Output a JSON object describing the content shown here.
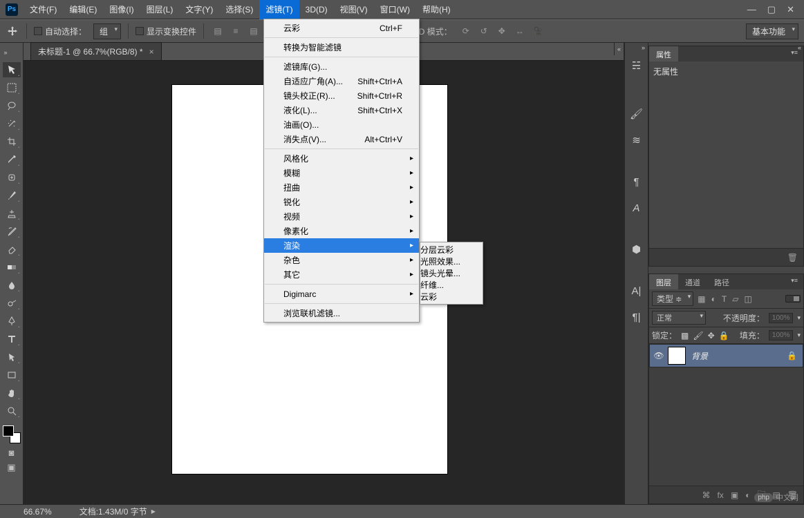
{
  "app": {
    "logo": "Ps"
  },
  "menu": {
    "items": [
      {
        "label": "文件(F)"
      },
      {
        "label": "编辑(E)"
      },
      {
        "label": "图像(I)"
      },
      {
        "label": "图层(L)"
      },
      {
        "label": "文字(Y)"
      },
      {
        "label": "选择(S)"
      },
      {
        "label": "滤镜(T)",
        "open": true
      },
      {
        "label": "3D(D)"
      },
      {
        "label": "视图(V)"
      },
      {
        "label": "窗口(W)"
      },
      {
        "label": "帮助(H)"
      }
    ]
  },
  "filter_menu": {
    "items": [
      {
        "label": "云彩",
        "shortcut": "Ctrl+F"
      },
      "sep",
      {
        "label": "转换为智能滤镜"
      },
      "sep",
      {
        "label": "滤镜库(G)..."
      },
      {
        "label": "自适应广角(A)...",
        "shortcut": "Shift+Ctrl+A"
      },
      {
        "label": "镜头校正(R)...",
        "shortcut": "Shift+Ctrl+R"
      },
      {
        "label": "液化(L)...",
        "shortcut": "Shift+Ctrl+X"
      },
      {
        "label": "油画(O)..."
      },
      {
        "label": "消失点(V)...",
        "shortcut": "Alt+Ctrl+V"
      },
      "sep",
      {
        "label": "风格化",
        "sub": true
      },
      {
        "label": "模糊",
        "sub": true
      },
      {
        "label": "扭曲",
        "sub": true
      },
      {
        "label": "锐化",
        "sub": true
      },
      {
        "label": "视频",
        "sub": true
      },
      {
        "label": "像素化",
        "sub": true
      },
      {
        "label": "渲染",
        "sub": true,
        "hover": true
      },
      {
        "label": "杂色",
        "sub": true
      },
      {
        "label": "其它",
        "sub": true
      },
      "sep",
      {
        "label": "Digimarc",
        "sub": true
      },
      "sep",
      {
        "label": "浏览联机滤镜..."
      }
    ]
  },
  "render_submenu": {
    "items": [
      {
        "label": "分层云彩"
      },
      {
        "label": "光照效果..."
      },
      {
        "label": "镜头光晕..."
      },
      {
        "label": "纤维..."
      },
      {
        "label": "云彩",
        "hover": true
      }
    ]
  },
  "options": {
    "auto_select": "自动选择：",
    "group": "组",
    "show_transform": "显示变换控件",
    "mode_3d": "3D 模式：",
    "workspace": "基本功能"
  },
  "doc": {
    "tab_title": "未标题-1 @ 66.7%(RGB/8) *"
  },
  "panels": {
    "properties": {
      "tab": "属性",
      "empty": "无属性"
    },
    "layers": {
      "tabs": {
        "layers": "图层",
        "channels": "通道",
        "paths": "路径"
      },
      "kind": "类型",
      "blend": "正常",
      "opacity_label": "不透明度：",
      "opacity_value": "100%",
      "lock_label": "锁定：",
      "fill_label": "填充：",
      "fill_value": "100%",
      "layer_name": "背景"
    }
  },
  "status": {
    "zoom": "66.67%",
    "doc_info": "文档:1.43M/0 字节"
  },
  "watermark": {
    "badge": "php",
    "text": "中文网"
  }
}
